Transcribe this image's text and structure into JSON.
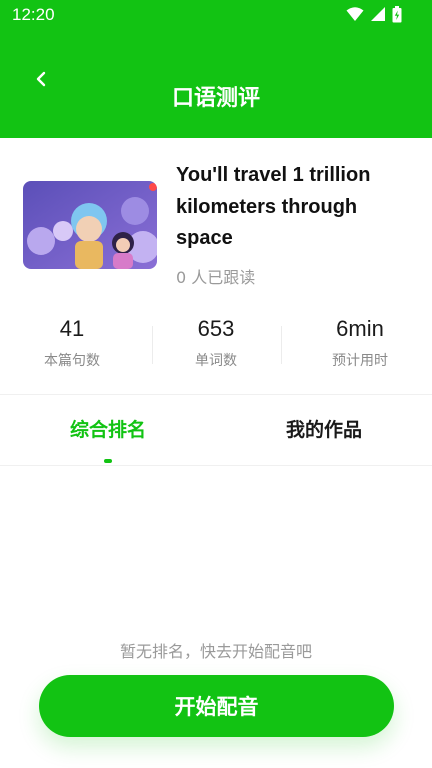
{
  "status_bar": {
    "time": "12:20",
    "icons": [
      "wifi-icon",
      "signal-icon",
      "battery-icon"
    ]
  },
  "header": {
    "title": "口语测评",
    "back_icon": "chevron-left-icon"
  },
  "story": {
    "title": "You'll travel 1 trillion kilometers through space",
    "followers": "0 人已跟读"
  },
  "stats": [
    {
      "value": "41",
      "label": "本篇句数"
    },
    {
      "value": "653",
      "label": "单词数"
    },
    {
      "value": "6min",
      "label": "预计用时"
    }
  ],
  "tabs": [
    {
      "label": "综合排名",
      "active": true
    },
    {
      "label": "我的作品",
      "active": false
    }
  ],
  "empty_state": "暂无排名，快去开始配音吧",
  "actions": {
    "start_label": "开始配音"
  },
  "colors": {
    "accent": "#12c313",
    "muted_text": "#9a9a9a"
  }
}
